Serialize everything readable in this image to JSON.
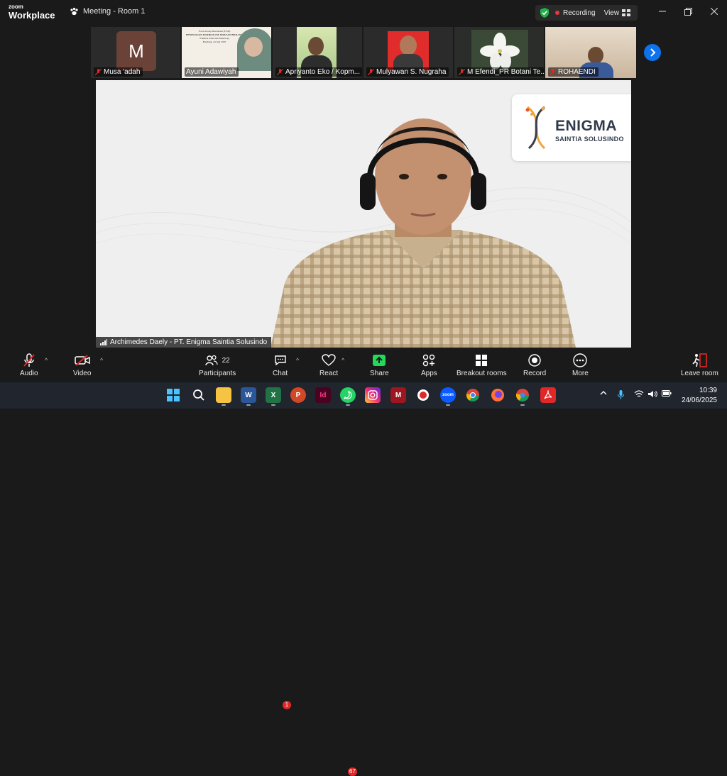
{
  "app": {
    "brand_small": "zoom",
    "brand_large": "Workplace",
    "meeting_title": "Meeting - Room 1"
  },
  "recording": {
    "label": "Recording",
    "view_label": "View",
    "status_color": "#e5393b"
  },
  "participants_strip": [
    {
      "name": "Musa 'adah",
      "avatar_letter": "M"
    },
    {
      "name": "Ayuni Adawiyah"
    },
    {
      "name": "Apriyanto Eko / Kopm..."
    },
    {
      "name": "Mulyawan S. Nugraha"
    },
    {
      "name": "M Efendi_PR Botani Te..."
    },
    {
      "name": "ROHAENDI"
    }
  ],
  "main_video": {
    "speaker_name": "Archimedes Daely - PT. Enigma Saintia Solusindo",
    "logo": {
      "title": "ENIGMA",
      "subtitle": "SAINTIA SOLUSINDO"
    },
    "slide_text": {
      "l1": "Focus Group Discussion (FGD)",
      "l2": "PENINJAUAN KURIKULUM JURUSAN BIOLOGI",
      "l3": "Fakultas Sains dan Teknologi",
      "l4": "Bandung, 24 Juni 2025"
    }
  },
  "toolbar": {
    "audio": "Audio",
    "video": "Video",
    "participants": "Participants",
    "participants_count": "22",
    "chat": "Chat",
    "chat_badge": "1",
    "react": "React",
    "share": "Share",
    "apps": "Apps",
    "breakout": "Breakout rooms",
    "record": "Record",
    "more": "More",
    "leave": "Leave room"
  },
  "taskbar": {
    "whatsapp_badge": "67",
    "time": "10:39",
    "date": "24/06/2025",
    "icons": [
      "windows-start-icon",
      "search-icon",
      "file-explorer-icon",
      "word-icon",
      "excel-icon",
      "powerpoint-icon",
      "indesign-icon",
      "whatsapp-icon",
      "instagram-icon",
      "mendeley-icon",
      "record-app-icon",
      "zoom-icon",
      "chrome-icon",
      "firefox-icon",
      "chrome-profile-icon",
      "acrobat-icon"
    ]
  },
  "colors": {
    "accent_blue": "#0e72ed",
    "danger": "#e02828",
    "share_green": "#23d959"
  }
}
